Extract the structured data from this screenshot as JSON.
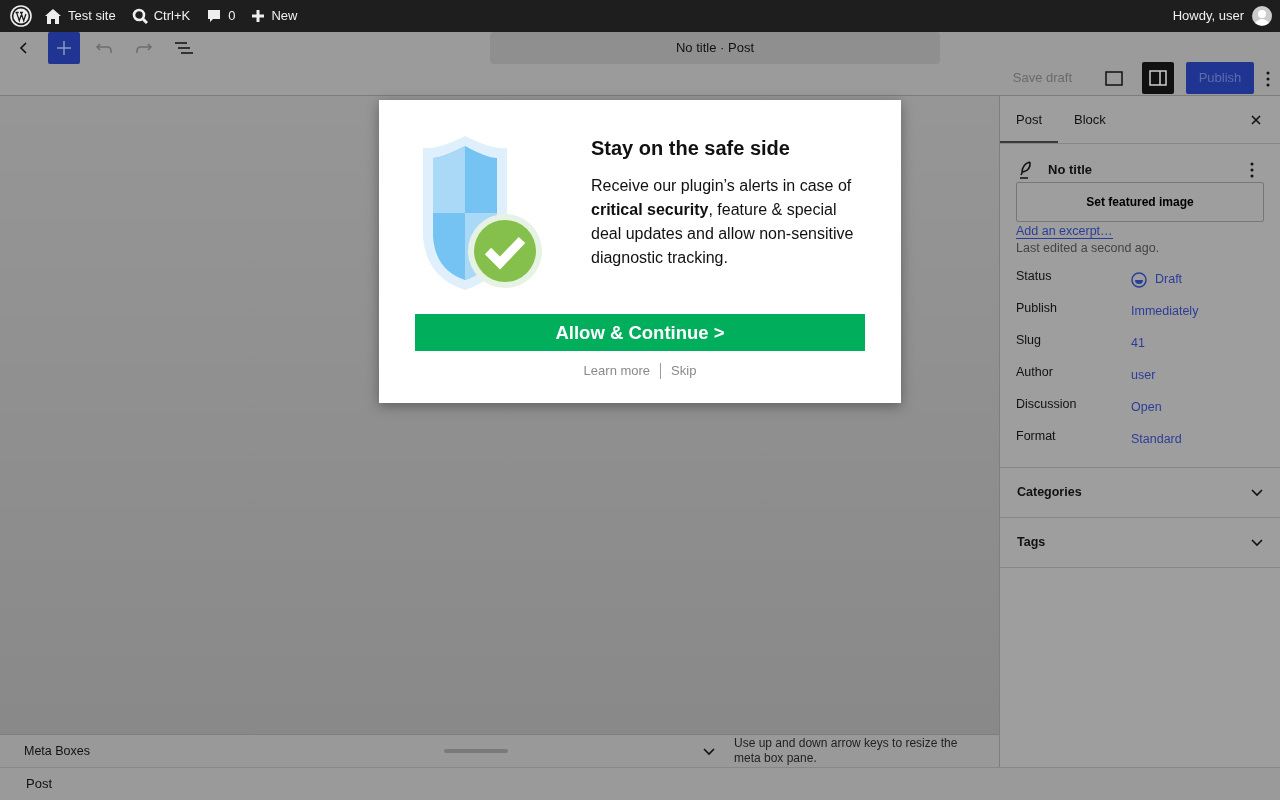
{
  "admin_bar": {
    "items": [
      {
        "kind": "wp-logo"
      },
      {
        "kind": "home",
        "label": "Test site"
      },
      {
        "kind": "search",
        "label": "Ctrl+K"
      },
      {
        "kind": "comments",
        "label": "0"
      },
      {
        "kind": "new",
        "label": "New"
      }
    ],
    "greeting": "Howdy, user"
  },
  "toolbar": {
    "document_title": "No title · Post",
    "save_draft": "Save draft",
    "publish": "Publish",
    "settings_pressed": true
  },
  "modal": {
    "title": "Stay on the safe side",
    "body": "Receive our plugin’s alerts in case of **critical security**, feature & special deal updates and allow non-sensitive diagnostic tracking.",
    "primary_button": "Allow & Continue >",
    "links": [
      "Learn more",
      "Skip"
    ]
  },
  "sidebar": {
    "tabs": [
      {
        "label": "Post",
        "selected": true
      },
      {
        "label": "Block",
        "selected": false
      }
    ],
    "post_title": "No title",
    "featured_image_button": "Set featured image",
    "excerpt_link": "Add an excerpt…",
    "last_edited": "Last edited a second ago.",
    "fields": [
      {
        "label": "Status",
        "value": "Draft",
        "kind": "status"
      },
      {
        "label": "Publish",
        "value": "Immediately",
        "kind": "link"
      },
      {
        "label": "Slug",
        "value": "41",
        "kind": "link"
      },
      {
        "label": "Author",
        "value": "user",
        "kind": "link"
      },
      {
        "label": "Discussion",
        "value": "Open",
        "kind": "link"
      },
      {
        "label": "Format",
        "value": "Standard",
        "kind": "link"
      }
    ],
    "panels": [
      {
        "label": "Categories",
        "expanded": false
      },
      {
        "label": "Tags",
        "expanded": false
      }
    ]
  },
  "meta_boxes": {
    "title": "Meta Boxes",
    "hint": "Use up and down arrow keys to resize the meta box pane."
  },
  "breadcrumb": "Post"
}
